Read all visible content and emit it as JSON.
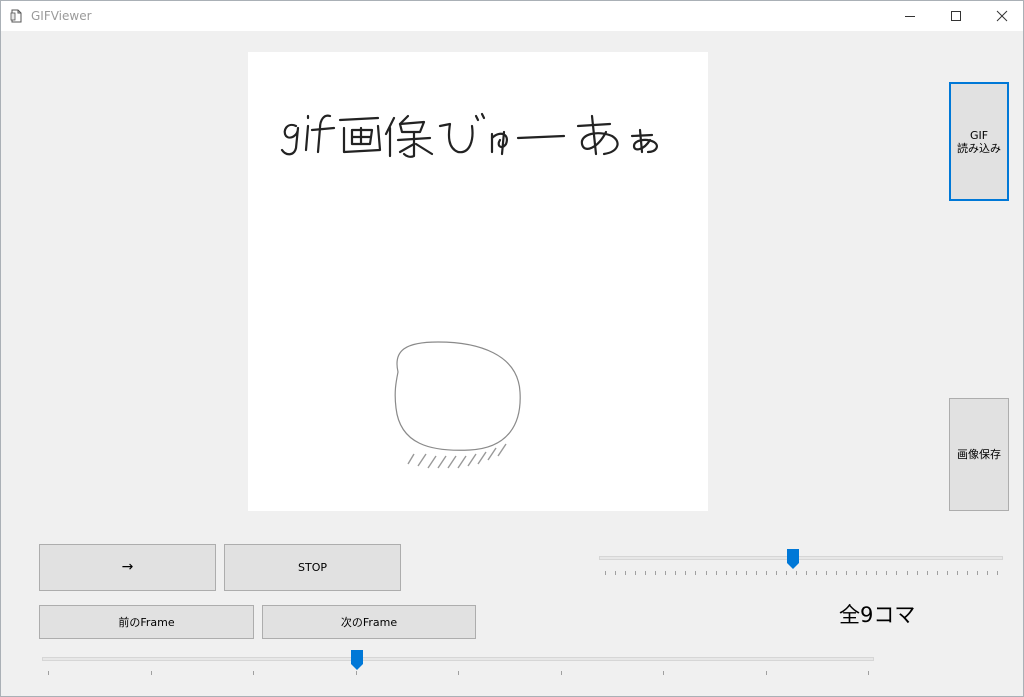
{
  "window": {
    "title": "GIFViewer"
  },
  "canvas": {
    "handwritten_caption": "gif画像びゅーあぁ"
  },
  "buttons": {
    "load_gif": "GIF\n読み込み",
    "save_image": "画像保存",
    "play": "→",
    "stop": "STOP",
    "prev_frame": "前のFrame",
    "next_frame": "次のFrame"
  },
  "speed_slider": {
    "value_fraction": 0.48
  },
  "frame_slider": {
    "value_fraction": 0.377
  },
  "status": {
    "frame_count": "全9コマ"
  },
  "colors": {
    "accent": "#0078d7",
    "button_bg": "#e1e1e1",
    "window_bg": "#f0f0f0"
  }
}
